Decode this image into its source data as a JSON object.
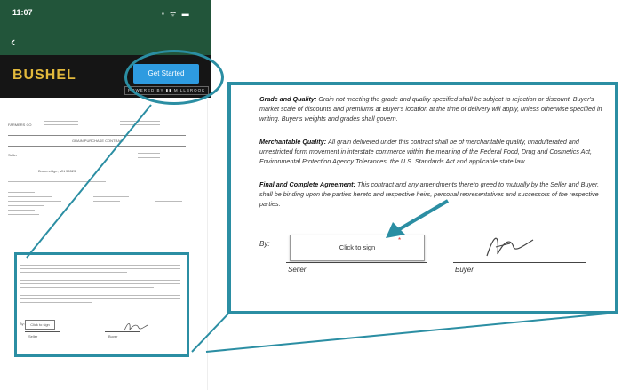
{
  "phone": {
    "time": "11:07",
    "status_icons": "▪ ᯤ ▬",
    "back": "‹",
    "logo": "BUSHEL",
    "get_started": "Get Started",
    "powered_by": "POWERED BY ▮▮ MILLBROOK"
  },
  "mini_doc": {
    "title": "GRAIN PURCHASE CONTRACT",
    "seller_label": "Seller",
    "location": "Brokenridge, MN 56523",
    "sign_button": "Click to sign",
    "seller": "Seller",
    "buyer": "Buyer"
  },
  "zoom": {
    "grade_title": "Grade and Quality:",
    "grade_text": "Grain not meeting the grade and quality specified shall be subject to rejection or discount. Buyer's market scale of discounts and premiums at Buyer's location at the time of delivery will apply, unless otherwise specified in writing. Buyer's weights and grades shall govern.",
    "merch_title": "Merchantable Quality:",
    "merch_text": "All grain delivered under this contract shall be of merchantable quality, unadulterated and unrestricted form movement in interstate commerce within the meaning of the Federal Food, Drug and Cosmetics Act, Environmental Protection Agency Tolerances, the U.S. Standards Act and applicable state law.",
    "final_title": "Final and Complete Agreement:",
    "final_text": "This contract and any amendments thereto greed to mutually by the Seller and Buyer, shall be binding upon the parties hereto and respective heirs, personal representatives and successors of the respective parties.",
    "by_label": "By:",
    "sign_button": "Click to sign",
    "asterisk": "*",
    "seller_label": "Seller",
    "buyer_label": "Buyer"
  },
  "colors": {
    "accent_teal": "#2b8ea3",
    "status_green": "#22553a",
    "banner_black": "#151515",
    "logo_gold": "#e2b93c",
    "button_blue": "#2e9be0"
  }
}
